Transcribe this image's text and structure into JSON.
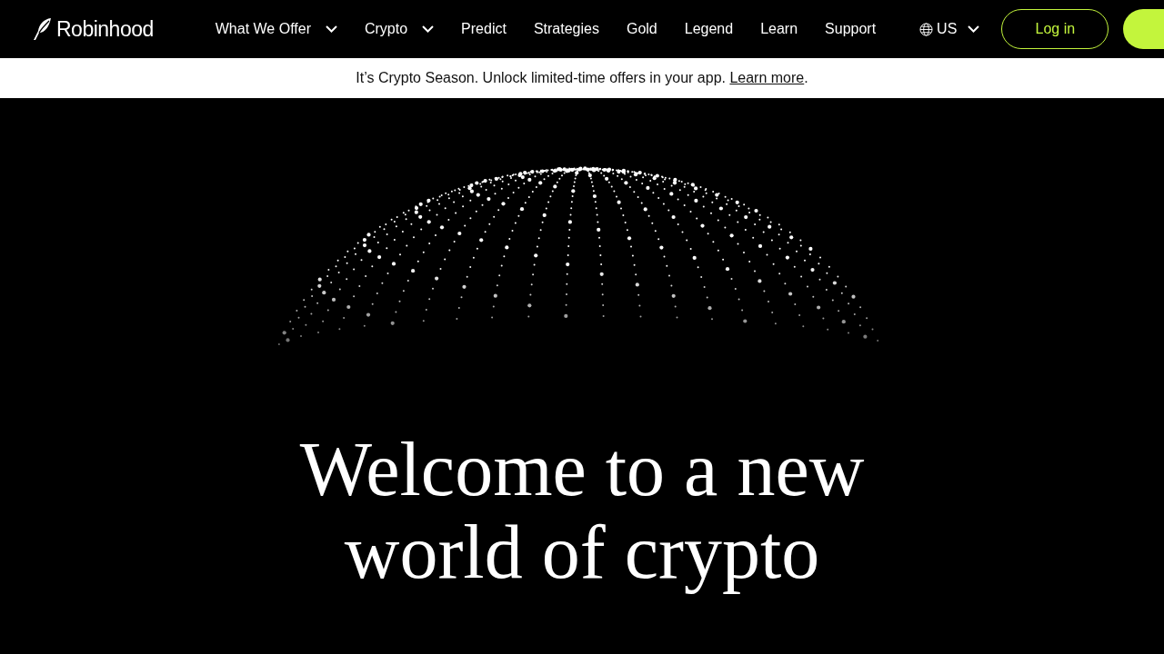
{
  "navbar": {
    "logo": "Robinhood",
    "items": [
      {
        "label": "What We Offer",
        "dropdown": true
      },
      {
        "label": "Crypto",
        "dropdown": true
      },
      {
        "label": "Predict",
        "dropdown": false
      },
      {
        "label": "Strategies",
        "dropdown": false
      },
      {
        "label": "Gold",
        "dropdown": false
      },
      {
        "label": "Legend",
        "dropdown": false
      },
      {
        "label": "Learn",
        "dropdown": false
      },
      {
        "label": "Support",
        "dropdown": false
      }
    ],
    "region": "US",
    "login": "Log in"
  },
  "banner": {
    "text": "It’s Crypto Season. Unlock limited-time offers in your app.",
    "link": "Learn more",
    "end": "."
  },
  "hero": {
    "heading_lines": [
      "Welcome to a new",
      "world of crypto"
    ]
  }
}
